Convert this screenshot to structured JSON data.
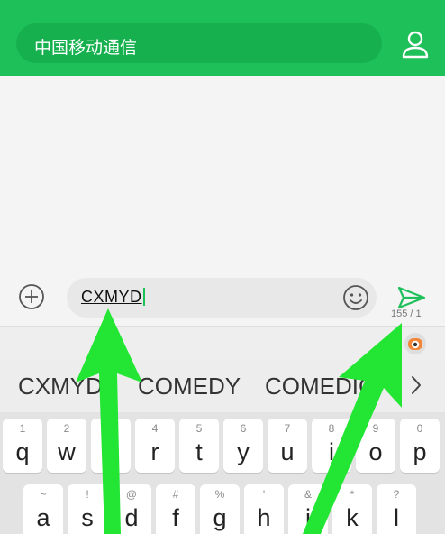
{
  "header": {
    "recipient": "中国移动通信",
    "contact_icon": "person-outline-icon"
  },
  "compose": {
    "plus_icon": "circle-plus-icon",
    "input_value": "CXMYD",
    "emoji_icon": "smiley-icon",
    "send_icon": "paper-plane-send-icon",
    "counter": "155 / 1"
  },
  "keyboard_toolbar": {
    "app_icon": "robot-mascot-icon"
  },
  "suggestions": {
    "items": [
      "CXMYD",
      "COMEDY",
      "COMEDIC"
    ],
    "more_icon": "chevron-right-icon"
  },
  "keyboard": {
    "row1": [
      {
        "hint": "1",
        "char": "q"
      },
      {
        "hint": "2",
        "char": "w"
      },
      {
        "hint": "3",
        "char": "e"
      },
      {
        "hint": "4",
        "char": "r"
      },
      {
        "hint": "5",
        "char": "t"
      },
      {
        "hint": "6",
        "char": "y"
      },
      {
        "hint": "7",
        "char": "u"
      },
      {
        "hint": "8",
        "char": "i"
      },
      {
        "hint": "9",
        "char": "o"
      },
      {
        "hint": "0",
        "char": "p"
      }
    ],
    "row2": [
      {
        "hint": "~",
        "char": "a"
      },
      {
        "hint": "!",
        "char": "s"
      },
      {
        "hint": "@",
        "char": "d"
      },
      {
        "hint": "#",
        "char": "f"
      },
      {
        "hint": "%",
        "char": "g"
      },
      {
        "hint": "'",
        "char": "h"
      },
      {
        "hint": "&",
        "char": "j"
      },
      {
        "hint": "*",
        "char": "k"
      },
      {
        "hint": "?",
        "char": "l"
      }
    ]
  },
  "colors": {
    "brand_green": "#1ec05a",
    "arrow_green": "#22e633"
  }
}
